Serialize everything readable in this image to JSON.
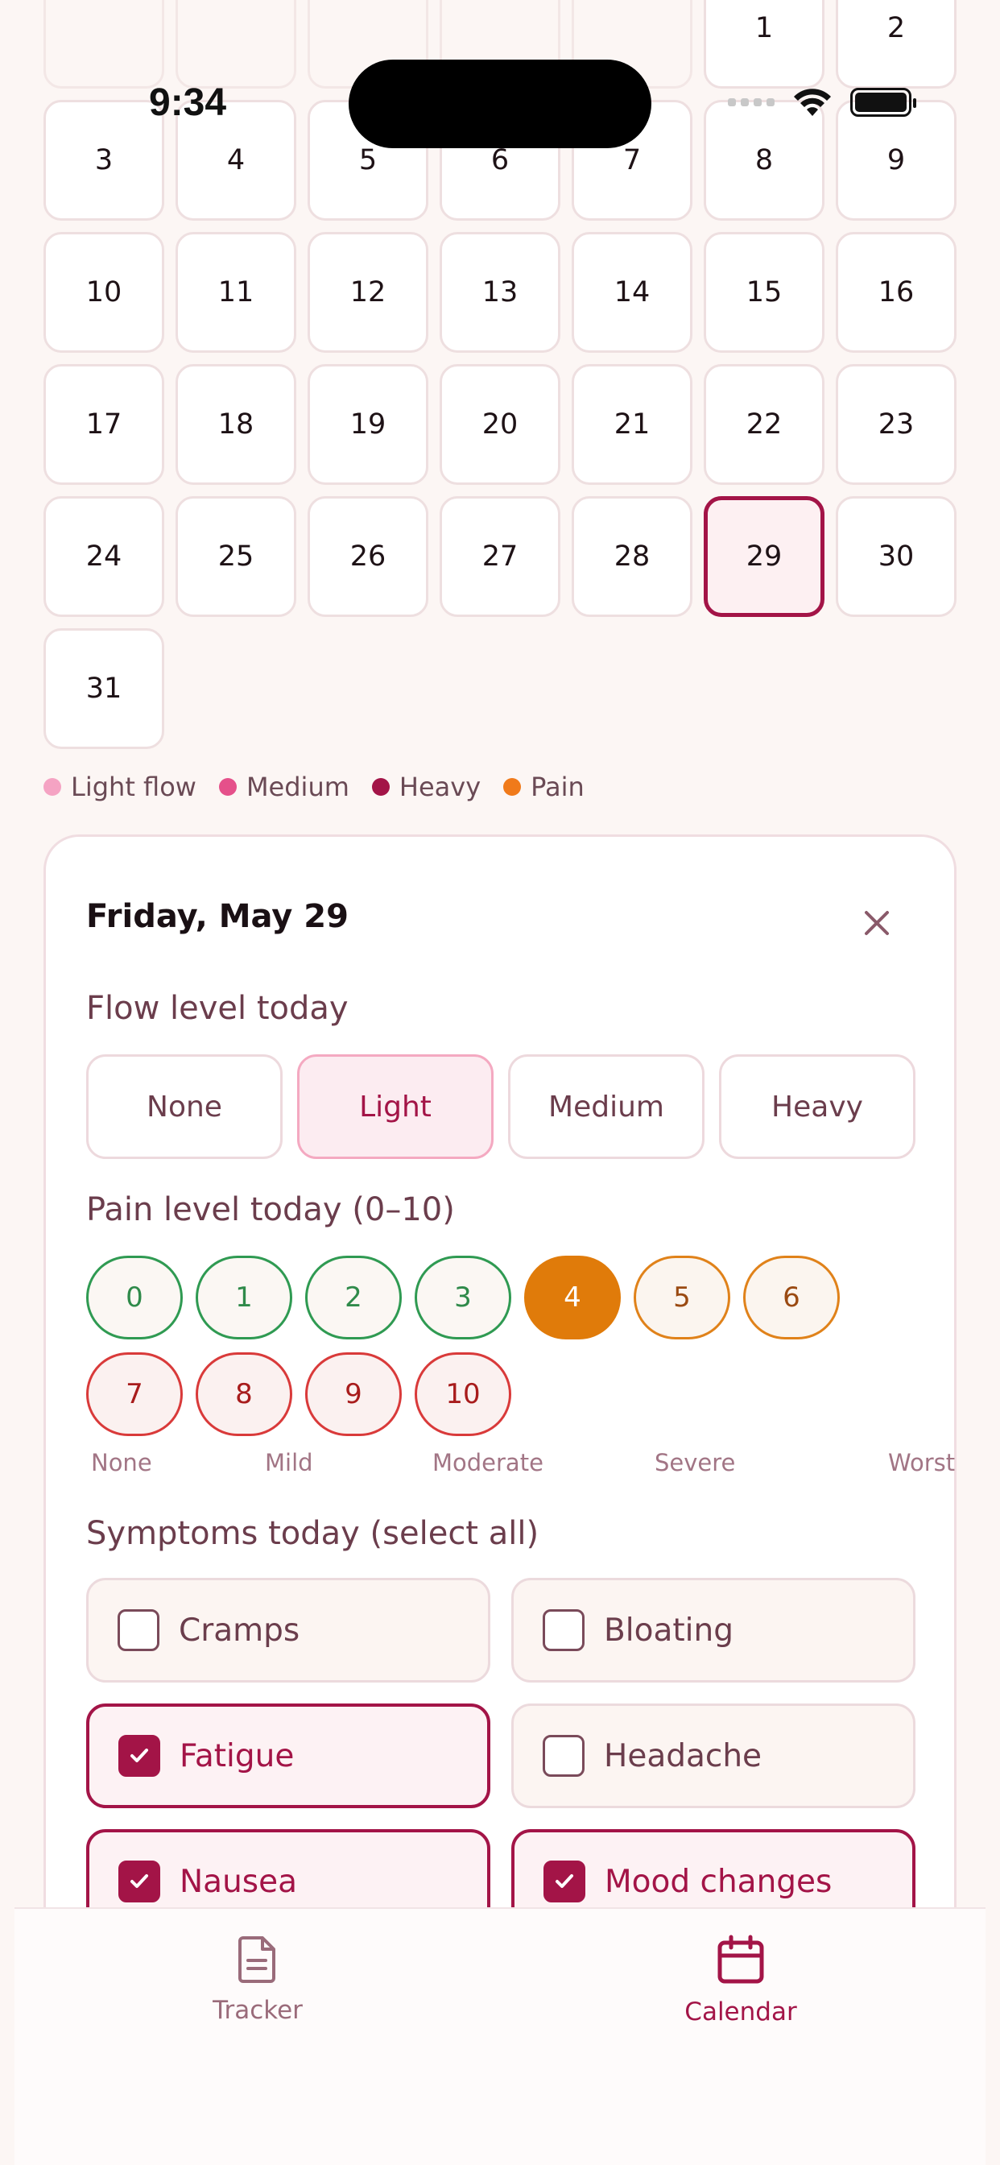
{
  "status_bar": {
    "time": "9:34"
  },
  "calendar": {
    "partial_top_row": [
      "",
      "",
      "",
      "",
      "",
      "1",
      "2"
    ],
    "weeks": [
      [
        "3",
        "4",
        "5",
        "6",
        "7",
        "8",
        "9"
      ],
      [
        "10",
        "11",
        "12",
        "13",
        "14",
        "15",
        "16"
      ],
      [
        "17",
        "18",
        "19",
        "20",
        "21",
        "22",
        "23"
      ],
      [
        "24",
        "25",
        "26",
        "27",
        "28",
        "29",
        "30"
      ],
      [
        "31"
      ]
    ],
    "selected_day": "29"
  },
  "legend": [
    {
      "label": "Light flow",
      "color": "#f5a3c3"
    },
    {
      "label": "Medium",
      "color": "#e5508a"
    },
    {
      "label": "Heavy",
      "color": "#a31447"
    },
    {
      "label": "Pain",
      "color": "#f07a1a"
    }
  ],
  "detail": {
    "title": "Friday, May 29",
    "flow_label": "Flow level today",
    "flow_options": [
      "None",
      "Light",
      "Medium",
      "Heavy"
    ],
    "flow_selected": "Light",
    "pain_label": "Pain level today (0–10)",
    "pain_levels": [
      "0",
      "1",
      "2",
      "3",
      "4",
      "5",
      "6",
      "7",
      "8",
      "9",
      "10"
    ],
    "pain_selected": "4",
    "pain_scale": [
      "None",
      "Mild",
      "Moderate",
      "Severe",
      "Worst"
    ],
    "symptoms_label": "Symptoms today (select all)",
    "symptoms": [
      {
        "label": "Cramps",
        "checked": false
      },
      {
        "label": "Bloating",
        "checked": false
      },
      {
        "label": "Fatigue",
        "checked": true
      },
      {
        "label": "Headache",
        "checked": false
      },
      {
        "label": "Nausea",
        "checked": true
      },
      {
        "label": "Mood changes",
        "checked": true
      }
    ]
  },
  "tabbar": {
    "tracker": "Tracker",
    "calendar": "Calendar",
    "active": "Calendar"
  },
  "colors": {
    "accent": "#a31447",
    "pain_selected": "#e07b0a",
    "background": "#fcf6f4"
  }
}
